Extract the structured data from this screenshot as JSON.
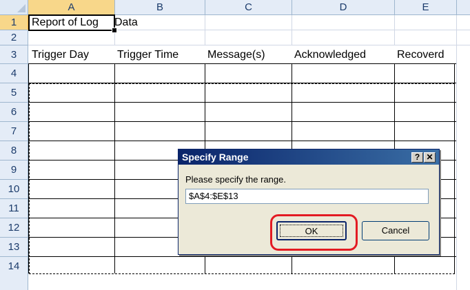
{
  "columns": [
    "A",
    "B",
    "C",
    "D",
    "E"
  ],
  "rows": [
    "1",
    "2",
    "3",
    "4",
    "5",
    "6",
    "7",
    "8",
    "9",
    "10",
    "11",
    "12",
    "13",
    "14"
  ],
  "cells": {
    "a1": "Report of Log",
    "b1": "Data",
    "headers": [
      "Trigger Day",
      "Trigger Time",
      "Message(s)",
      "Acknowledged",
      "Recoverd"
    ]
  },
  "dialog": {
    "title": "Specify Range",
    "help_glyph": "?",
    "close_glyph": "✕",
    "prompt": "Please specify the range.",
    "range_value": "$A$4:$E$13",
    "ok_label": "OK",
    "cancel_label": "Cancel"
  },
  "colors": {
    "highlight": "#e31b23",
    "title_bar": "#0a246a",
    "selected_header": "#f8d78a"
  }
}
